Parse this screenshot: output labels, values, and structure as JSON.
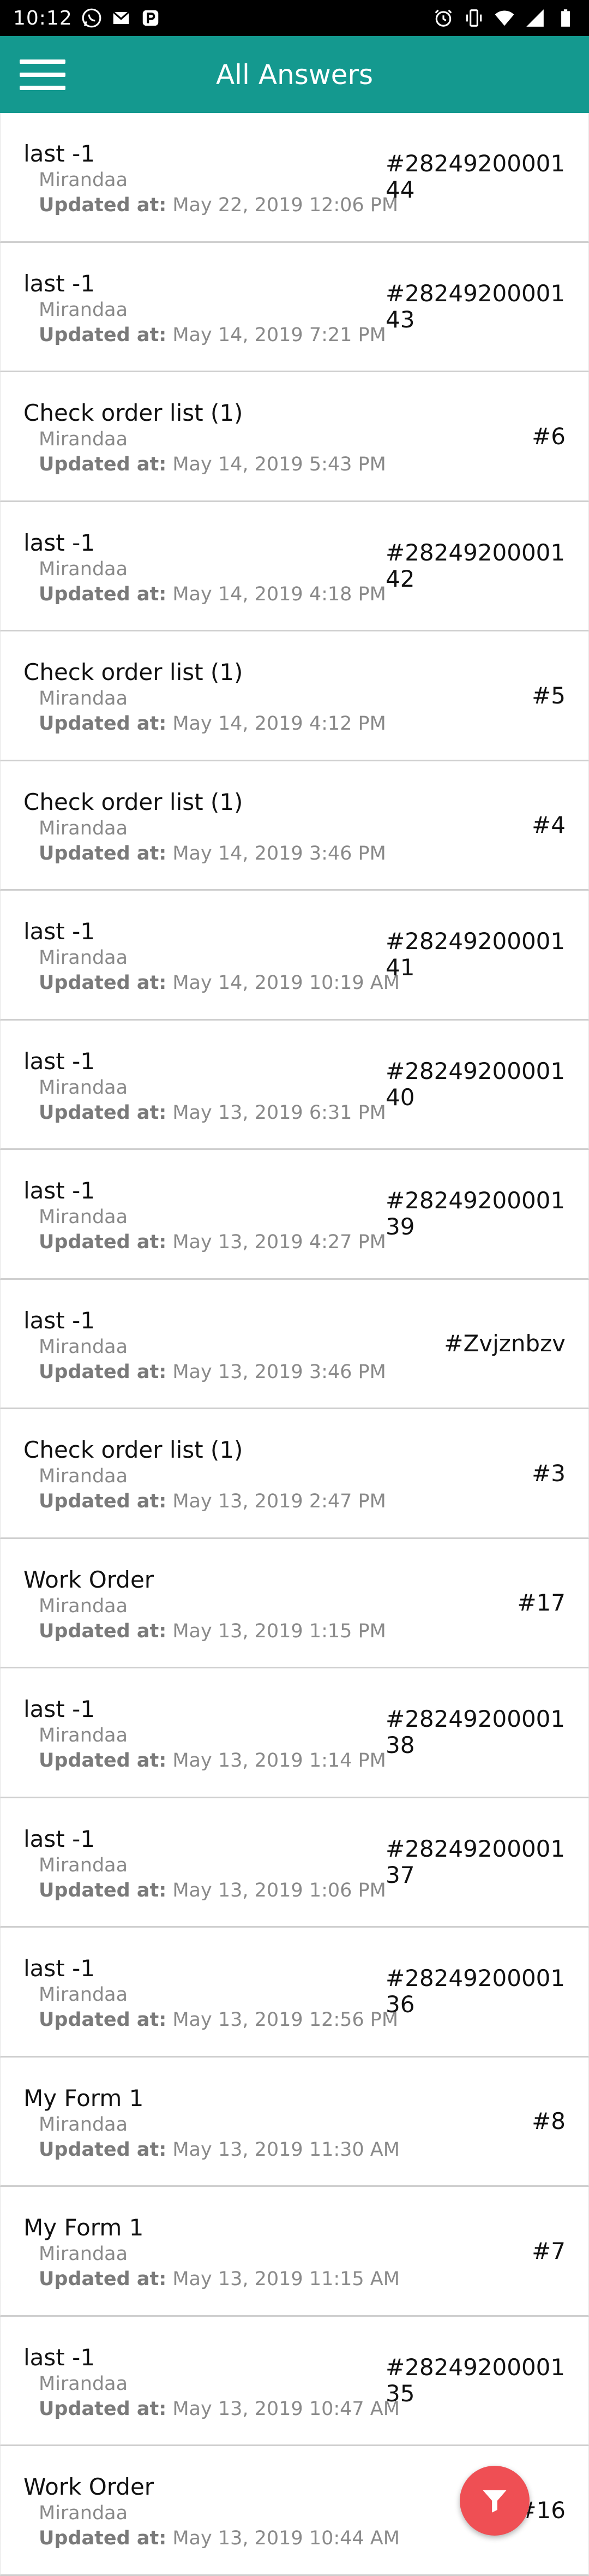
{
  "status_bar": {
    "time": "10:12",
    "left_icons": [
      "whatsapp-icon",
      "gmail-icon",
      "p-app-icon"
    ],
    "right_icons": [
      "alarm-icon",
      "vibrate-icon",
      "wifi-icon",
      "signal-icon",
      "battery-icon"
    ]
  },
  "app_bar": {
    "title": "All Answers",
    "background": "#14998f"
  },
  "labels": {
    "updated_prefix": "Updated at:"
  },
  "items": [
    {
      "title": "last -1",
      "author": "Mirandaa",
      "updated": "May 22, 2019 12:06 PM",
      "id": "#2824920000144",
      "long": true
    },
    {
      "title": "last -1",
      "author": "Mirandaa",
      "updated": "May 14, 2019 7:21 PM",
      "id": "#2824920000143",
      "long": true
    },
    {
      "title": "Check order list (1)",
      "author": "Mirandaa",
      "updated": "May 14, 2019 5:43 PM",
      "id": "#6",
      "long": false
    },
    {
      "title": "last -1",
      "author": "Mirandaa",
      "updated": "May 14, 2019 4:18 PM",
      "id": "#2824920000142",
      "long": true
    },
    {
      "title": "Check order list (1)",
      "author": "Mirandaa",
      "updated": "May 14, 2019 4:12 PM",
      "id": "#5",
      "long": false
    },
    {
      "title": "Check order list (1)",
      "author": "Mirandaa",
      "updated": "May 14, 2019 3:46 PM",
      "id": "#4",
      "long": false
    },
    {
      "title": "last -1",
      "author": "Mirandaa",
      "updated": "May 14, 2019 10:19 AM",
      "id": "#2824920000141",
      "long": true
    },
    {
      "title": "last -1",
      "author": "Mirandaa",
      "updated": "May 13, 2019 6:31 PM",
      "id": "#2824920000140",
      "long": true
    },
    {
      "title": "last -1",
      "author": "Mirandaa",
      "updated": "May 13, 2019 4:27 PM",
      "id": "#2824920000139",
      "long": true
    },
    {
      "title": "last -1",
      "author": "Mirandaa",
      "updated": "May 13, 2019 3:46 PM",
      "id": "#Zvjznbzv",
      "long": false
    },
    {
      "title": "Check order list (1)",
      "author": "Mirandaa",
      "updated": "May 13, 2019 2:47 PM",
      "id": "#3",
      "long": false
    },
    {
      "title": "Work Order",
      "author": "Mirandaa",
      "updated": "May 13, 2019 1:15 PM",
      "id": "#17",
      "long": false
    },
    {
      "title": "last -1",
      "author": "Mirandaa",
      "updated": "May 13, 2019 1:14 PM",
      "id": "#2824920000138",
      "long": true
    },
    {
      "title": "last -1",
      "author": "Mirandaa",
      "updated": "May 13, 2019 1:06 PM",
      "id": "#2824920000137",
      "long": true
    },
    {
      "title": "last -1",
      "author": "Mirandaa",
      "updated": "May 13, 2019 12:56 PM",
      "id": "#2824920000136",
      "long": true
    },
    {
      "title": "My Form 1",
      "author": "Mirandaa",
      "updated": "May 13, 2019 11:30 AM",
      "id": "#8",
      "long": false
    },
    {
      "title": "My Form 1",
      "author": "Mirandaa",
      "updated": "May 13, 2019 11:15 AM",
      "id": "#7",
      "long": false
    },
    {
      "title": "last -1",
      "author": "Mirandaa",
      "updated": "May 13, 2019 10:47 AM",
      "id": "#2824920000135",
      "long": true
    },
    {
      "title": "Work Order",
      "author": "Mirandaa",
      "updated": "May 13, 2019 10:44 AM",
      "id": "#16",
      "long": false
    }
  ],
  "fab": {
    "icon": "filter-icon",
    "color": "#ef4f54"
  }
}
